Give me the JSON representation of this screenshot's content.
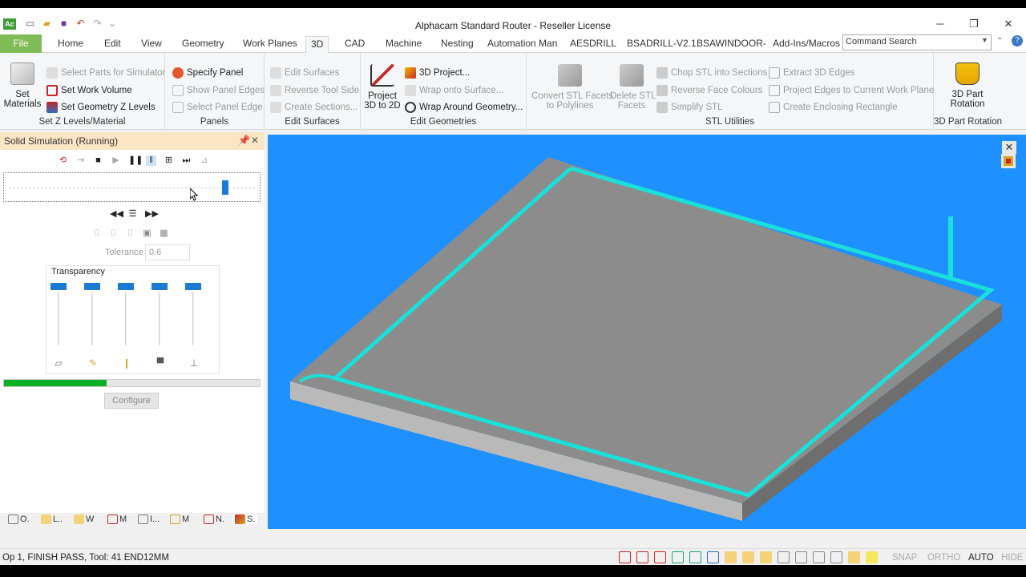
{
  "window": {
    "title": "Alphacam Standard Router - Reseller License",
    "logo_text": "Ac"
  },
  "tabs": [
    "File",
    "Home",
    "Edit",
    "View",
    "Geometry",
    "Work Planes",
    "3D",
    "CAD",
    "Machine",
    "Nesting",
    "Automation Man",
    "AESDRILL",
    "BSADRILL-V2.1",
    "BSAWINDOOR-V5",
    "Add-Ins/Macros"
  ],
  "active_tab": "3D",
  "command_search": {
    "placeholder": "Command Search"
  },
  "ribbon": {
    "set_z": {
      "big_label": "Set\nMaterials",
      "items": [
        "Select Parts for Simulator",
        "Set Work Volume",
        "Set Geometry Z Levels"
      ],
      "label": "Set Z Levels/Material"
    },
    "panels": {
      "items": [
        "Specify Panel",
        "Show Panel Edges",
        "Select Panel Edge"
      ],
      "label": "Panels"
    },
    "edit_surfaces": {
      "items": [
        "Edit Surfaces",
        "Reverse Tool Side",
        "Create Sections..."
      ],
      "label": "Edit Surfaces"
    },
    "edit_geometries": {
      "big_label": "Project\n3D to 2D",
      "items": [
        "3D Project...",
        "Wrap onto Surface...",
        "Wrap Around Geometry..."
      ],
      "label": "Edit Geometries"
    },
    "stl": {
      "big1": "Convert STL Facets\nto Polylines",
      "big2": "Delete STL\nFacets",
      "items_col1": [
        "Chop STL into Sections",
        "Reverse Face Colours",
        "Simplify STL"
      ],
      "items_col2": [
        "Extract 3D Edges",
        "Project Edges to Current Work Plane",
        "Create Enclosing Rectangle"
      ],
      "label": "STL Utilities"
    },
    "rotation": {
      "big_label": "3D Part\nRotation",
      "label": "3D Part Rotation"
    }
  },
  "sim_panel": {
    "title": "Solid Simulation (Running)",
    "slider_position": 0.88,
    "tolerance_label": "Tolerance",
    "tolerance_value": "0.6",
    "transparency_label": "Transparency",
    "progress": 0.4,
    "configure_label": "Configure",
    "bottom_tabs": [
      "O.",
      "L..",
      "W",
      "M",
      "I...",
      "M",
      "N.",
      "S."
    ]
  },
  "status": {
    "text": "Op 1, FINISH PASS, Tool: 41 END12MM",
    "snap": "SNAP",
    "ortho": "ORTHO",
    "auto": "AUTO",
    "hide": "HIDE"
  },
  "colors": {
    "viewport_bg": "#1e90ff",
    "panel_top": "#8c8c8c",
    "toolpath": "#19e0d8",
    "progress": "#06b025",
    "slider": "#1b7bd2"
  }
}
